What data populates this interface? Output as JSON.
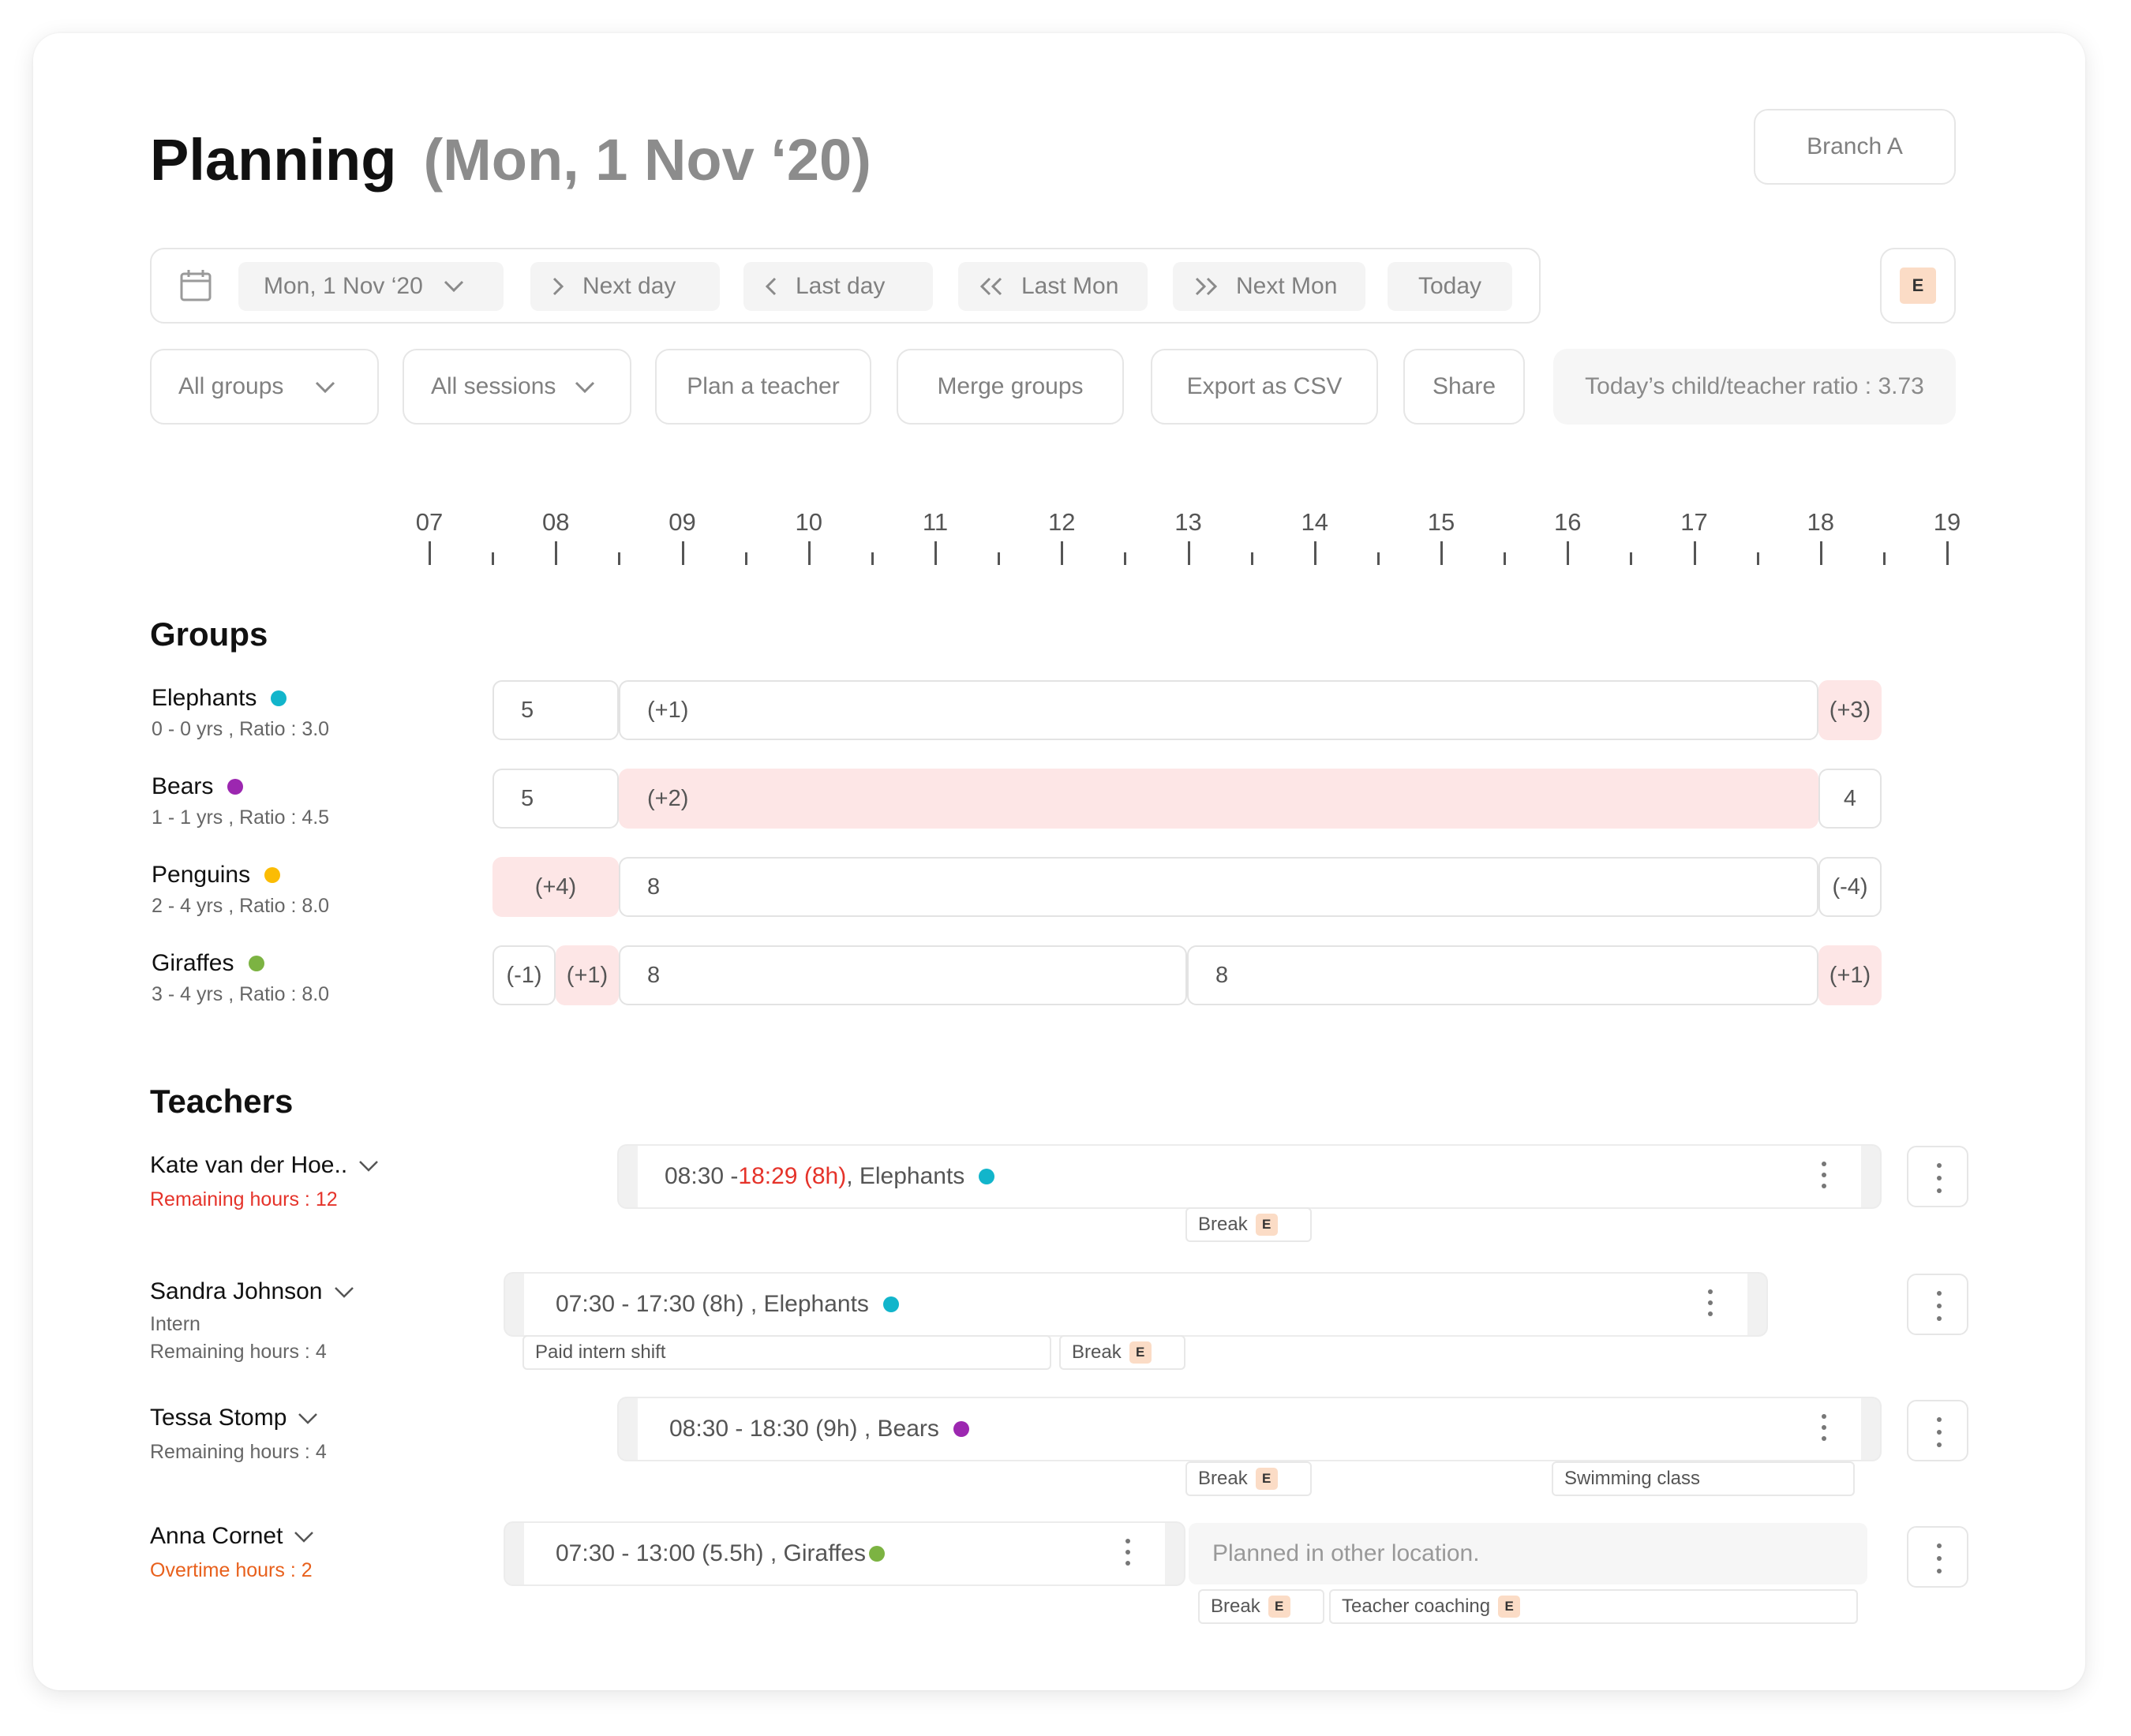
{
  "header": {
    "title": "Planning",
    "subtitle": "(Mon, 1 Nov ‘20)",
    "branch": "Branch A",
    "profile_badge": "E"
  },
  "date_nav": {
    "date": "Mon, 1 Nov ‘20",
    "next_day": "Next day",
    "last_day": "Last day",
    "last_mon": "Last Mon",
    "next_mon": "Next Mon",
    "today": "Today"
  },
  "toolbar": {
    "all_groups": "All groups",
    "all_sessions": "All sessions",
    "plan_teacher": "Plan a teacher",
    "merge_groups": "Merge groups",
    "export_csv": "Export as CSV",
    "share": "Share",
    "ratio": "Today’s child/teacher ratio : 3.73"
  },
  "timeline": {
    "hours": [
      "07",
      "08",
      "09",
      "10",
      "11",
      "12",
      "13",
      "14",
      "15",
      "16",
      "17",
      "18",
      "19"
    ]
  },
  "groups": {
    "heading": "Groups",
    "items": [
      {
        "name": "Elephants",
        "sub": "0 - 0 yrs , Ratio : 3.0",
        "color": "#12b5cb",
        "segments": [
          "5",
          "(+1)",
          "(+3)"
        ]
      },
      {
        "name": "Bears",
        "sub": "1 - 1 yrs , Ratio : 4.5",
        "color": "#9c27b0",
        "segments": [
          "5",
          "(+2)",
          "4"
        ]
      },
      {
        "name": "Penguins",
        "sub": "2 - 4 yrs , Ratio : 8.0",
        "color": "#fbbc04",
        "segments": [
          "(+4)",
          "8",
          "(-4)"
        ]
      },
      {
        "name": "Giraffes",
        "sub": "3 - 4 yrs , Ratio : 8.0",
        "color": "#7cb342",
        "segments": [
          "(-1)",
          "(+1)",
          "8",
          "8",
          "(+1)"
        ]
      }
    ]
  },
  "teachers": {
    "heading": "Teachers",
    "items": [
      {
        "name": "Kate van der Hoe..",
        "sub": "Remaining hours : 12",
        "shift": {
          "start": "08:30 - ",
          "end": "18:29",
          "hours": "(8h)",
          "group": " , Elephants",
          "color": "#12b5cb"
        },
        "tags": [
          {
            "label": "Break",
            "badge": "E"
          }
        ]
      },
      {
        "name": "Sandra Johnson",
        "role": "Intern",
        "sub": "Remaining hours : 4",
        "shift": {
          "label": "07:30 - 17:30 (8h) , Elephants",
          "color": "#12b5cb"
        },
        "tags": [
          {
            "label": "Paid intern shift"
          },
          {
            "label": "Break",
            "badge": "E"
          }
        ]
      },
      {
        "name": "Tessa Stomp",
        "sub": "Remaining hours : 4",
        "shift": {
          "label": "08:30 - 18:30 (9h) , Bears",
          "color": "#9c27b0"
        },
        "tags": [
          {
            "label": "Break",
            "badge": "E"
          },
          {
            "label": "Swimming class"
          }
        ]
      },
      {
        "name": "Anna Cornet",
        "sub": "Overtime hours : 2",
        "shift": {
          "label": "07:30 - 13:00 (5.5h) , Giraffes",
          "color": "#7cb342"
        },
        "other": "Planned in other location.",
        "tags": [
          {
            "label": "Break",
            "badge": "E"
          },
          {
            "label": "Teacher coaching",
            "badge": "E"
          }
        ]
      }
    ]
  }
}
